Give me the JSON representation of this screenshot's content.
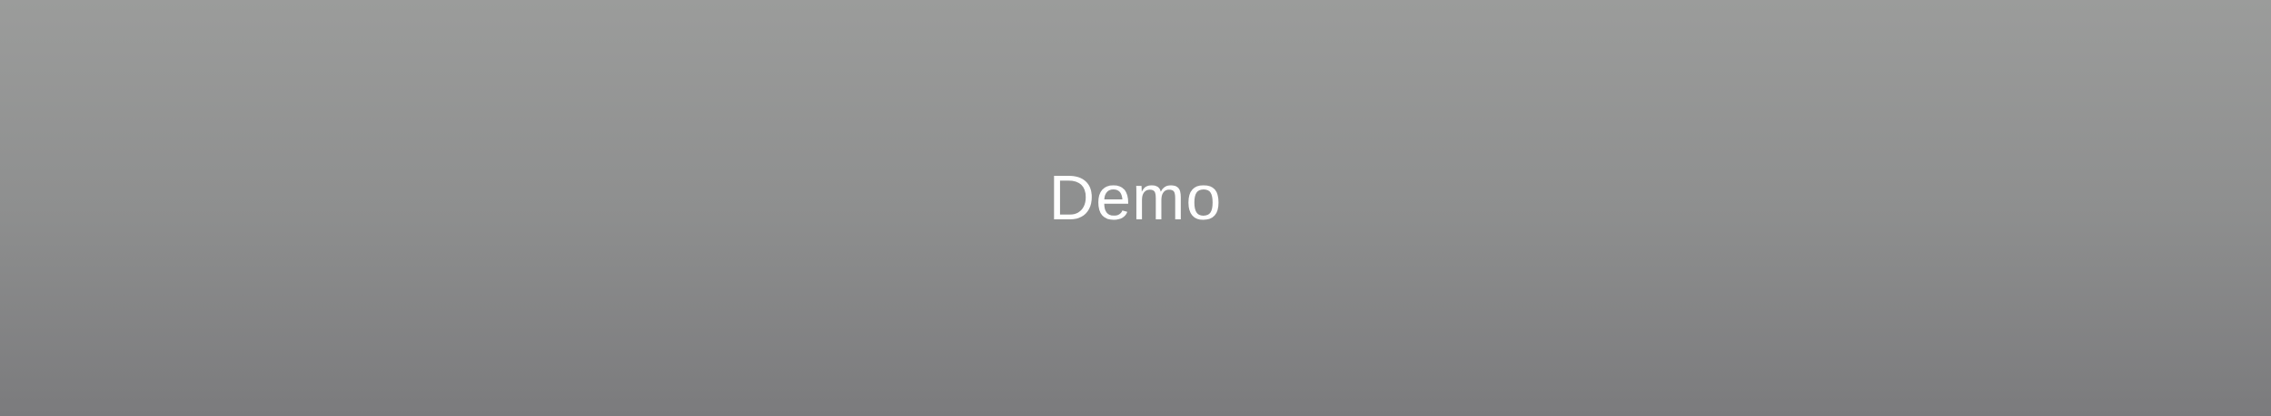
{
  "banner": {
    "title": "Demo",
    "colors": {
      "gradient_top": "#9b9c9b",
      "gradient_bottom": "#7b7b7d",
      "text": "#ffffff"
    }
  }
}
